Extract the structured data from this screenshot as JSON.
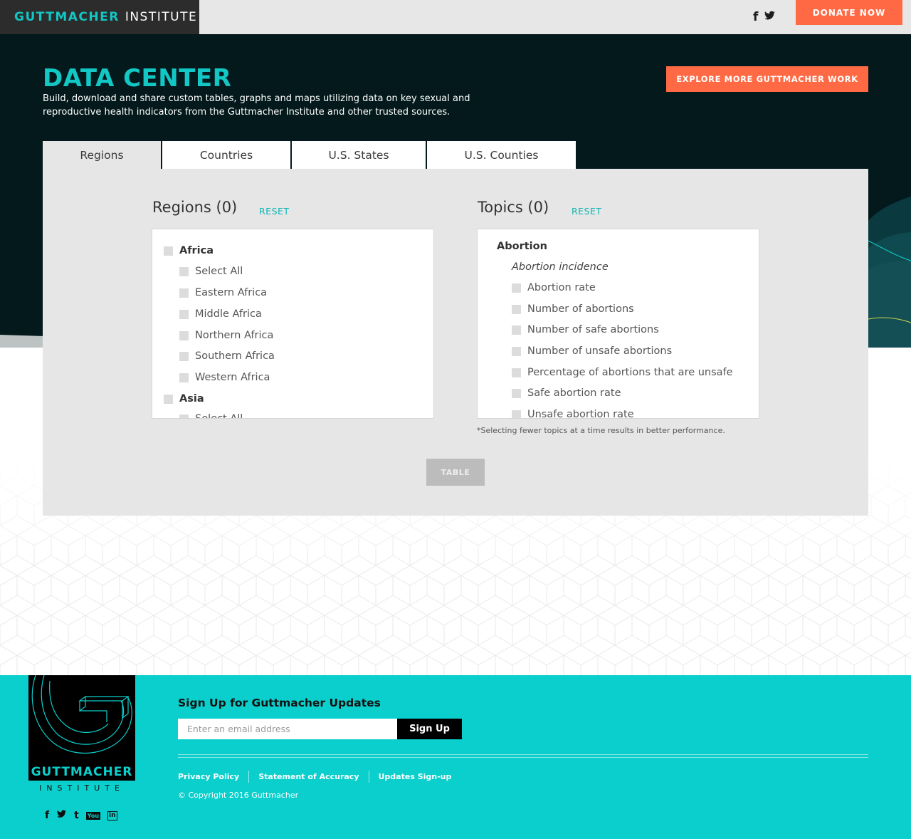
{
  "header": {
    "logo_primary": "GUTTMACHER",
    "logo_secondary": "INSTITUTE",
    "social": [
      "f",
      "𝕥"
    ],
    "donate_label": "DONATE NOW"
  },
  "hero": {
    "title": "DATA CENTER",
    "description": "Build, download and share custom tables, graphs and maps utilizing data on key sexual and reproductive health indicators from the Guttmacher Institute and other trusted sources.",
    "explore_label": "EXPLORE MORE GUTTMACHER WORK"
  },
  "tabs": [
    "Regions",
    "Countries",
    "U.S. States",
    "U.S. Counties"
  ],
  "regions": {
    "title": "Regions (0)",
    "reset": "RESET",
    "items": {
      "africa": "Africa",
      "select_all": "Select All",
      "eastern": "Eastern Africa",
      "middle": "Middle Africa",
      "northern": "Northern Africa",
      "southern": "Southern Africa",
      "western": "Western Africa",
      "asia": "Asia",
      "asia_select_all": "Select All"
    }
  },
  "topics": {
    "title": "Topics (0)",
    "reset": "RESET",
    "category": "Abortion",
    "subcategory": "Abortion incidence",
    "items": {
      "rate": "Abortion rate",
      "number": "Number of abortions",
      "safe_number": "Number of safe abortions",
      "unsafe_number": "Number of unsafe abortions",
      "pct_unsafe": "Percentage of abortions that are unsafe",
      "safe_rate": "Safe abortion rate",
      "unsafe_rate": "Unsafe abortion rate"
    },
    "note": "*Selecting fewer topics at a time results in better performance."
  },
  "table_button": "TABLE",
  "footer": {
    "logo_word": "GUTTMACHER",
    "logo_inst": "INSTITUTE",
    "social": [
      "f",
      "𝕥",
      "t",
      "You",
      "in"
    ],
    "signup_title": "Sign Up for Guttmacher Updates",
    "email_placeholder": "Enter an email address",
    "signup_label": "Sign Up",
    "links": {
      "privacy": "Privacy Policy",
      "accuracy": "Statement of Accuracy",
      "updates": "Updates Sign-up"
    },
    "copyright": "© Copyright 2016 Guttmacher"
  },
  "colors": {
    "accent": "#12c7c4",
    "cta": "#ff6a45",
    "hero_bg": "#03191c",
    "footer_bg": "#0acfcc",
    "panel_bg": "#e6e6e6"
  }
}
